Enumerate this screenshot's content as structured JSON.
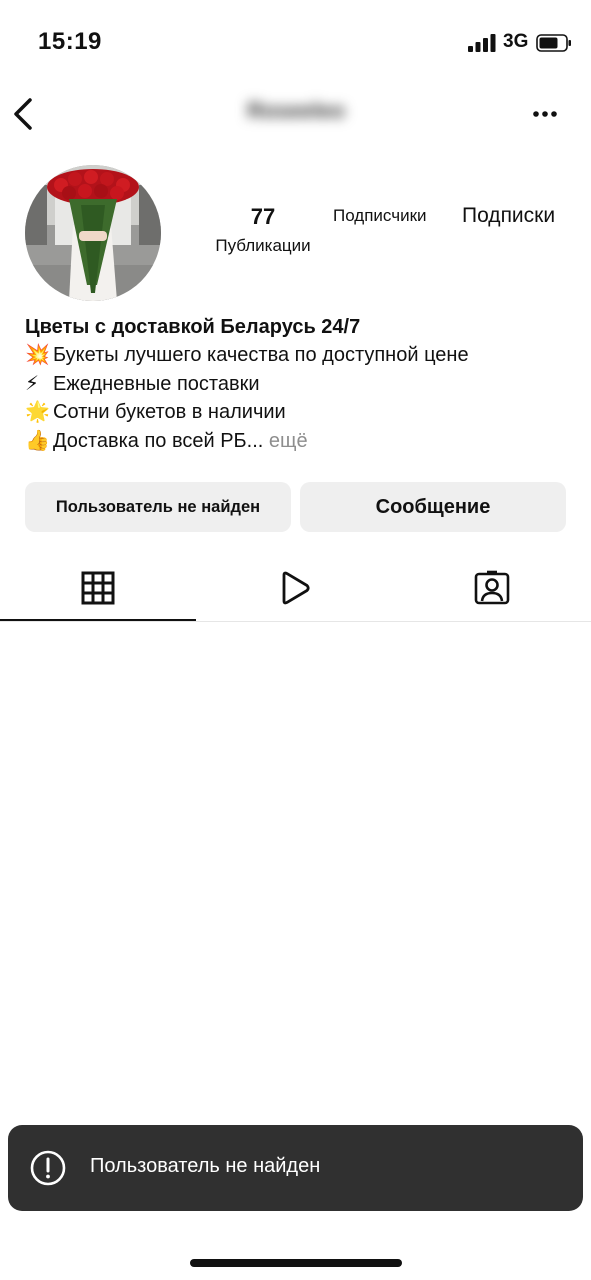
{
  "status_bar": {
    "time": "15:19",
    "network": "3G",
    "signal_icon": "signal-bars-icon",
    "battery_icon": "battery-icon"
  },
  "header": {
    "username": "Roseeleo",
    "back_icon": "chevron-left-icon",
    "more_icon": "more-dots-icon"
  },
  "profile": {
    "posts_count": "77",
    "posts_label": "Публикации",
    "followers_label": "Подписчики",
    "following_label": "Подписки"
  },
  "bio": {
    "name": "Цветы с доставкой Беларусь 24/7",
    "lines": [
      {
        "emoji": "💥",
        "text": "Букеты лучшего качества по доступной цене"
      },
      {
        "emoji": "⚡",
        "text": "Ежедневные поставки"
      },
      {
        "emoji": "🌟",
        "text": "Сотни букетов в наличии"
      },
      {
        "emoji": "👍",
        "text": "Доставка по всей РБ..."
      }
    ],
    "more": "ещё"
  },
  "buttons": {
    "user_not_found": "Пользователь не найден",
    "message": "Сообщение"
  },
  "tabs": [
    {
      "icon": "grid-icon",
      "active": true
    },
    {
      "icon": "reels-play-icon",
      "active": false
    },
    {
      "icon": "tagged-person-icon",
      "active": false
    }
  ],
  "toast": {
    "icon": "alert-circle-icon",
    "text": "Пользователь не найден"
  },
  "colors": {
    "button_bg": "#efefef",
    "toast_bg": "#303030",
    "muted_text": "#8e8e8e",
    "text": "#111111"
  }
}
